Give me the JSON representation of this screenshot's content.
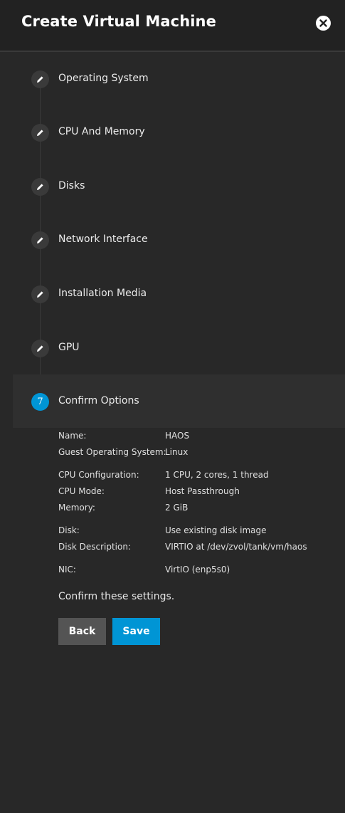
{
  "header": {
    "title": "Create Virtual Machine"
  },
  "steps": [
    {
      "label": "Operating System"
    },
    {
      "label": "CPU And Memory"
    },
    {
      "label": "Disks"
    },
    {
      "label": "Network Interface"
    },
    {
      "label": "Installation Media"
    },
    {
      "label": "GPU"
    },
    {
      "label": "Confirm Options",
      "number": "7"
    }
  ],
  "summary": {
    "name": {
      "label": "Name:",
      "value": "HAOS"
    },
    "guest_os": {
      "label": "Guest Operating System:",
      "value": "Linux"
    },
    "cpu_config": {
      "label": "CPU Configuration:",
      "value": "1 CPU, 2 cores, 1 thread"
    },
    "cpu_mode": {
      "label": "CPU Mode:",
      "value": "Host Passthrough"
    },
    "memory": {
      "label": "Memory:",
      "value": "2 GiB"
    },
    "disk": {
      "label": "Disk:",
      "value": "Use existing disk image"
    },
    "disk_desc": {
      "label": "Disk Description:",
      "value": "VIRTIO at /dev/zvol/tank/vm/haos"
    },
    "nic": {
      "label": "NIC:",
      "value": "VirtIO (enp5s0)"
    }
  },
  "confirm_text": "Confirm these settings.",
  "buttons": {
    "back": "Back",
    "save": "Save"
  },
  "colors": {
    "accent": "#0095d5",
    "background": "#282828",
    "header": "#222222"
  }
}
